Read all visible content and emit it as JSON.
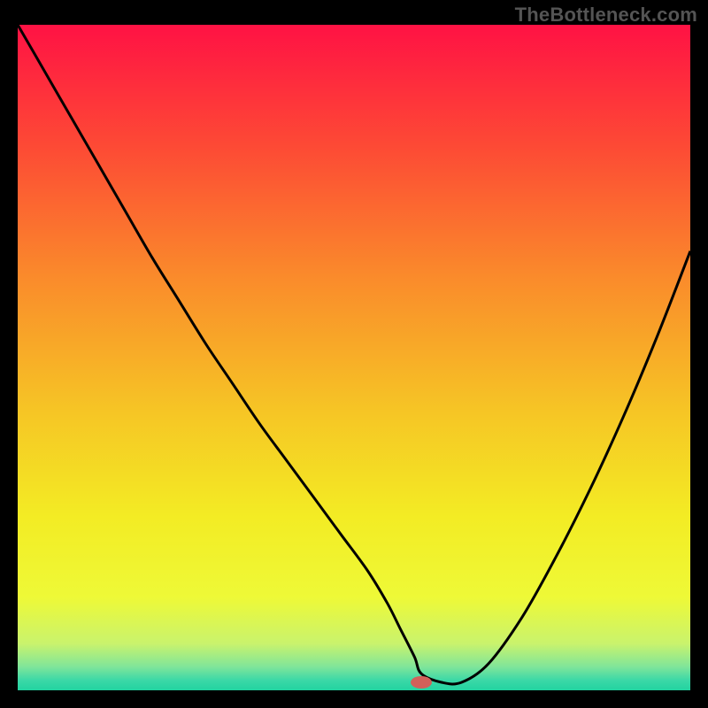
{
  "watermark": "TheBottleneck.com",
  "chart_data": {
    "type": "line",
    "title": "",
    "xlabel": "",
    "ylabel": "",
    "xlim": [
      0,
      100
    ],
    "ylim": [
      0,
      100
    ],
    "grid": false,
    "legend": false,
    "background_gradient_stops": [
      {
        "offset": 0.0,
        "color": "#ff1244"
      },
      {
        "offset": 0.18,
        "color": "#fd4935"
      },
      {
        "offset": 0.38,
        "color": "#fa8b2b"
      },
      {
        "offset": 0.58,
        "color": "#f6c525"
      },
      {
        "offset": 0.74,
        "color": "#f3ec24"
      },
      {
        "offset": 0.86,
        "color": "#eef937"
      },
      {
        "offset": 0.93,
        "color": "#c9f36d"
      },
      {
        "offset": 0.965,
        "color": "#7fe59a"
      },
      {
        "offset": 0.985,
        "color": "#3bd8a7"
      },
      {
        "offset": 1.0,
        "color": "#22d3a0"
      }
    ],
    "series": [
      {
        "name": "bottleneck-curve",
        "x": [
          0,
          4,
          8,
          12,
          16,
          20,
          24,
          28,
          32,
          36,
          40,
          44,
          48,
          52,
          55,
          57,
          59,
          60,
          63,
          66,
          70,
          75,
          80,
          85,
          90,
          95,
          100
        ],
        "y": [
          100,
          93,
          86,
          79,
          72,
          65,
          58.5,
          52,
          46,
          40,
          34.5,
          29,
          23.5,
          18,
          13,
          9,
          5,
          2.5,
          1.2,
          1.2,
          4,
          11,
          20,
          30,
          41,
          53,
          66
        ]
      }
    ],
    "marker": {
      "x_pct": 60,
      "y_pct": 1.2,
      "color": "#d2605a",
      "rx": 12,
      "ry": 7
    }
  }
}
